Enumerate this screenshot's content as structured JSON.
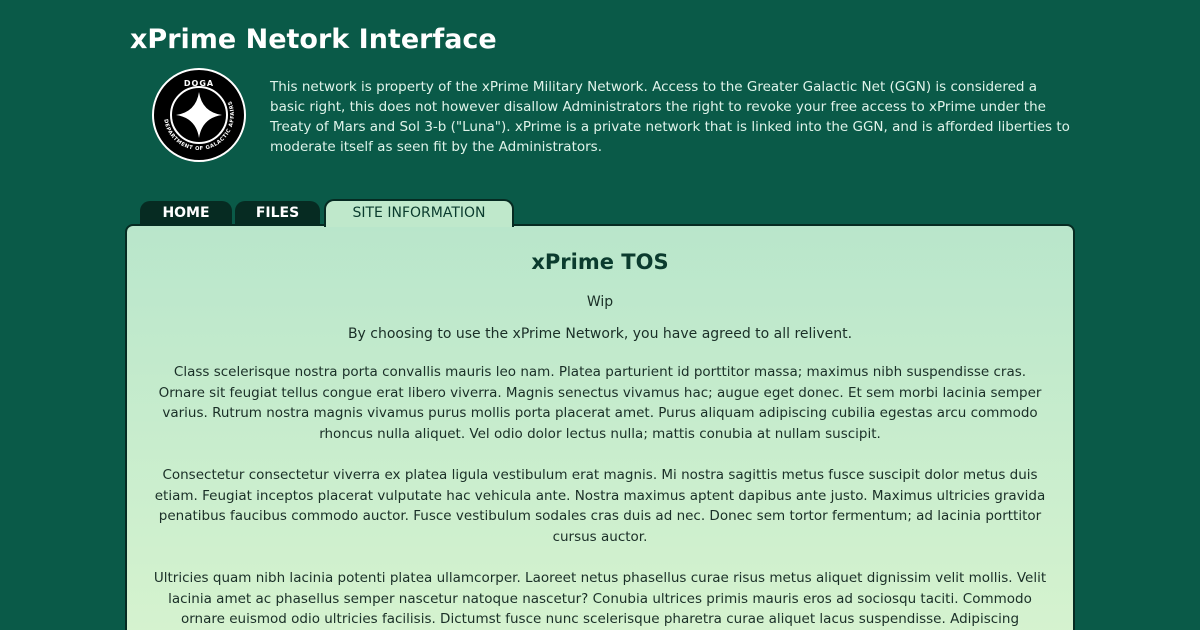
{
  "header": {
    "title": "xPrime Netork Interface",
    "logo_text": "DOGA",
    "logo_ring_text": "DEPARTMENT OF GALACTIC AFFAIRS",
    "intro": "This network is property of the xPrime Military Network. Access to the Greater Galactic Net (GGN) is considered a basic right, this does not however disallow Administrators the right to revoke your free access to xPrime under the Treaty of Mars and Sol 3-b (\"Luna\"). xPrime is a private network that is linked into the GGN, and is afforded liberties to moderate itself as seen fit by the Administrators."
  },
  "tabs": [
    {
      "label": "HOME"
    },
    {
      "label": "FILES"
    },
    {
      "label": "SITE INFORMATION"
    }
  ],
  "colors": {
    "background": "#0a5a48",
    "tab_dark": "#062b22",
    "panel": "#c8eecd"
  },
  "content": {
    "title": "xPrime TOS",
    "wip": "Wip",
    "agree": "By choosing to use the xPrime Network, you have agreed to all relivent.",
    "paragraphs": [
      "Class scelerisque nostra porta convallis mauris leo nam. Platea parturient id porttitor massa; maximus nibh suspendisse cras. Ornare sit feugiat tellus congue erat libero viverra. Magnis senectus vivamus hac; augue eget donec. Et sem morbi lacinia semper varius. Rutrum nostra magnis vivamus purus mollis porta placerat amet. Purus aliquam adipiscing cubilia egestas arcu commodo rhoncus nulla aliquet. Vel odio dolor lectus nulla; mattis conubia at nullam suscipit.",
      "Consectetur consectetur viverra ex platea ligula vestibulum erat magnis. Mi nostra sagittis metus fusce suscipit dolor metus duis etiam. Feugiat inceptos placerat vulputate hac vehicula ante. Nostra maximus aptent dapibus ante justo. Maximus ultricies gravida penatibus faucibus commodo auctor. Fusce vestibulum sodales cras duis ad nec. Donec sem tortor fermentum; ad lacinia porttitor cursus auctor.",
      "Ultricies quam nibh lacinia potenti platea ullamcorper. Laoreet netus phasellus curae risus metus aliquet dignissim velit mollis. Velit lacinia amet ac phasellus semper nascetur natoque nascetur? Conubia ultrices primis mauris eros ad sociosqu taciti. Commodo ornare euismod odio ultricies facilisis. Dictumst fusce nunc scelerisque pharetra curae aliquet lacus suspendisse. Adipiscing hendrerit sagittis"
    ]
  }
}
